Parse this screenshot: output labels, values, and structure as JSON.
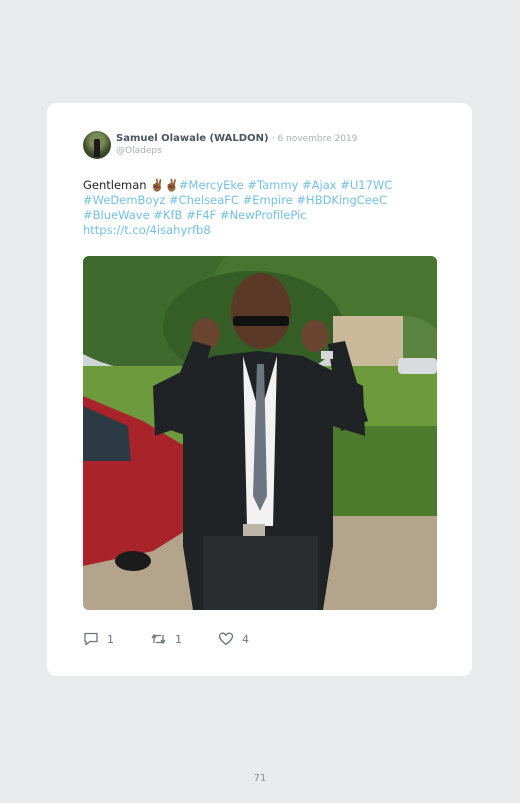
{
  "tweet": {
    "author_name": "Samuel Olawale (WALDON)",
    "date": "· 6 novembre 2019",
    "handle": "@Oladeps",
    "text_plain": "Gentleman ",
    "text_emoji": "✌🏾✌🏾",
    "text_hashtags_line1": "#MercyEke #Tammy #Ajax #U17WC",
    "text_hashtags_line2": "#WeDemBoyz #ChelseaFC #Empire #HBDKingCeeC",
    "text_hashtags_line3": "#BlueWave #KfB #F4F #NewProfilePic",
    "text_link": "https://t.co/4isahyrfb8",
    "photo_icon": "portrait-photo",
    "actions": {
      "reply_icon": "reply-icon",
      "reply_count": "1",
      "retweet_icon": "retweet-icon",
      "retweet_count": "1",
      "like_icon": "heart-icon",
      "like_count": "4"
    }
  },
  "page_number": "71",
  "colors": {
    "background": "#e8eaeb",
    "card": "#ffffff",
    "link": "#74bfe6",
    "meta": "#a8b0b6"
  }
}
